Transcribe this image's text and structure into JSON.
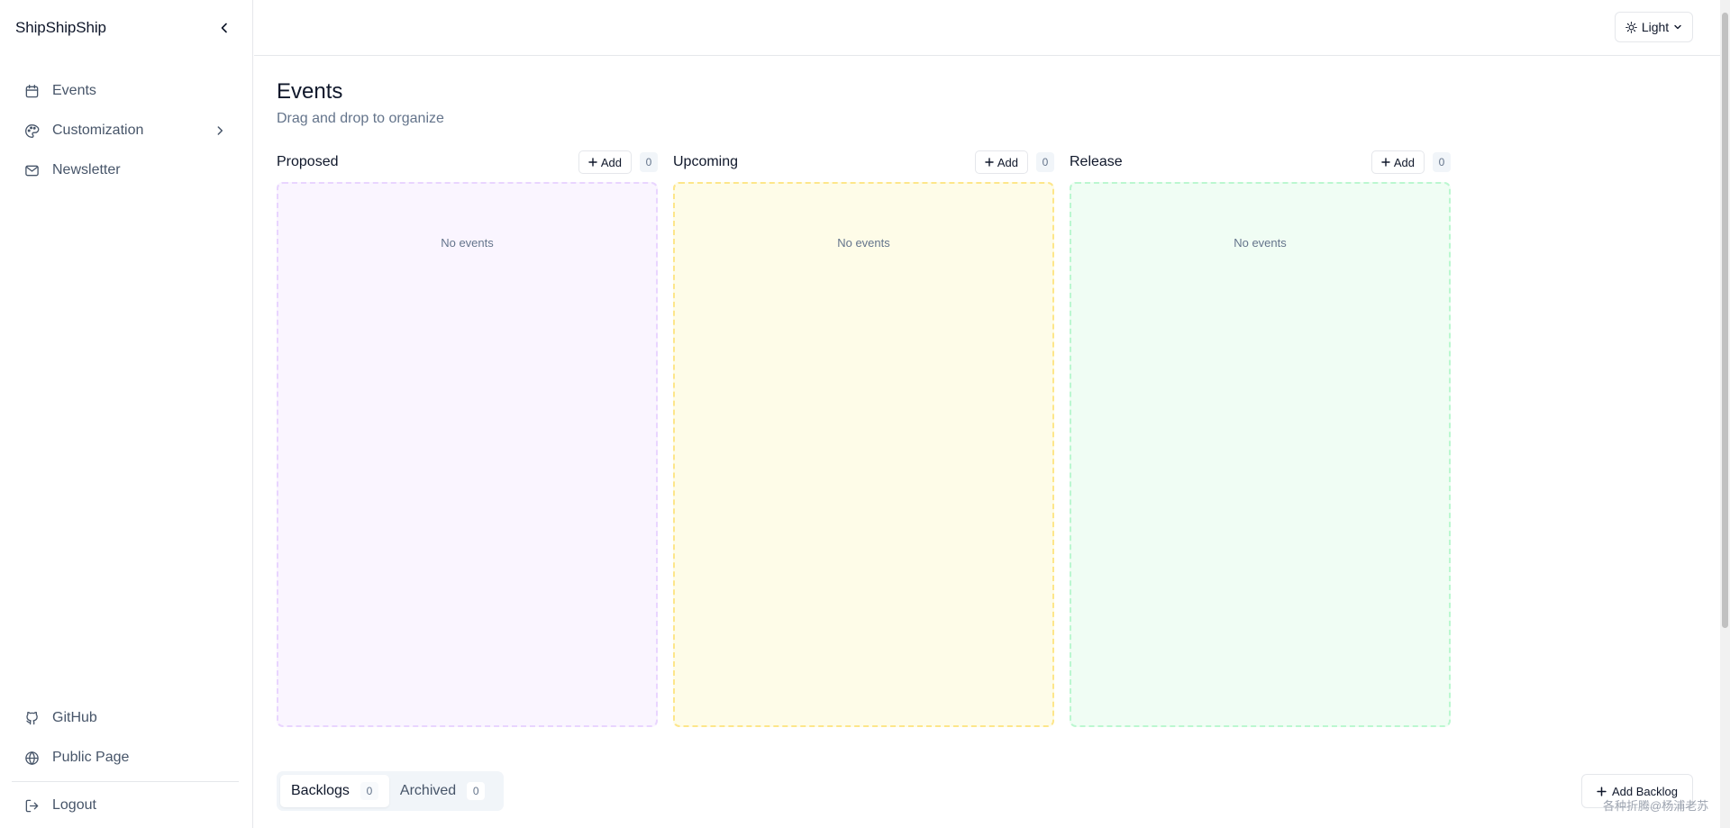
{
  "app": {
    "brand": "ShipShipShip"
  },
  "sidebar": {
    "items": [
      {
        "label": "Events",
        "icon": "calendar-icon"
      },
      {
        "label": "Customization",
        "icon": "palette-icon"
      },
      {
        "label": "Newsletter",
        "icon": "mail-icon"
      }
    ],
    "bottom_items": [
      {
        "label": "GitHub",
        "icon": "github-icon"
      },
      {
        "label": "Public Page",
        "icon": "globe-icon"
      }
    ],
    "logout": {
      "label": "Logout",
      "icon": "logout-icon"
    }
  },
  "topbar": {
    "theme_label": "Light",
    "theme_icon": "sun-icon"
  },
  "page": {
    "title": "Events",
    "subtitle": "Drag and drop to organize"
  },
  "columns": [
    {
      "title": "Proposed",
      "add_label": "Add",
      "count": "0",
      "empty_text": "No events",
      "bg": "#faf5ff",
      "border": "#e9d5ff"
    },
    {
      "title": "Upcoming",
      "add_label": "Add",
      "count": "0",
      "empty_text": "No events",
      "bg": "#fefce8",
      "border": "#fde68a"
    },
    {
      "title": "Release",
      "add_label": "Add",
      "count": "0",
      "empty_text": "No events",
      "bg": "#f0fdf4",
      "border": "#bbf7d0"
    }
  ],
  "tabs": [
    {
      "label": "Backlogs",
      "count": "0"
    },
    {
      "label": "Archived",
      "count": "0"
    }
  ],
  "actions": {
    "add_backlog_label": "Add Backlog"
  },
  "watermark": "各种折腾@杨浦老苏"
}
